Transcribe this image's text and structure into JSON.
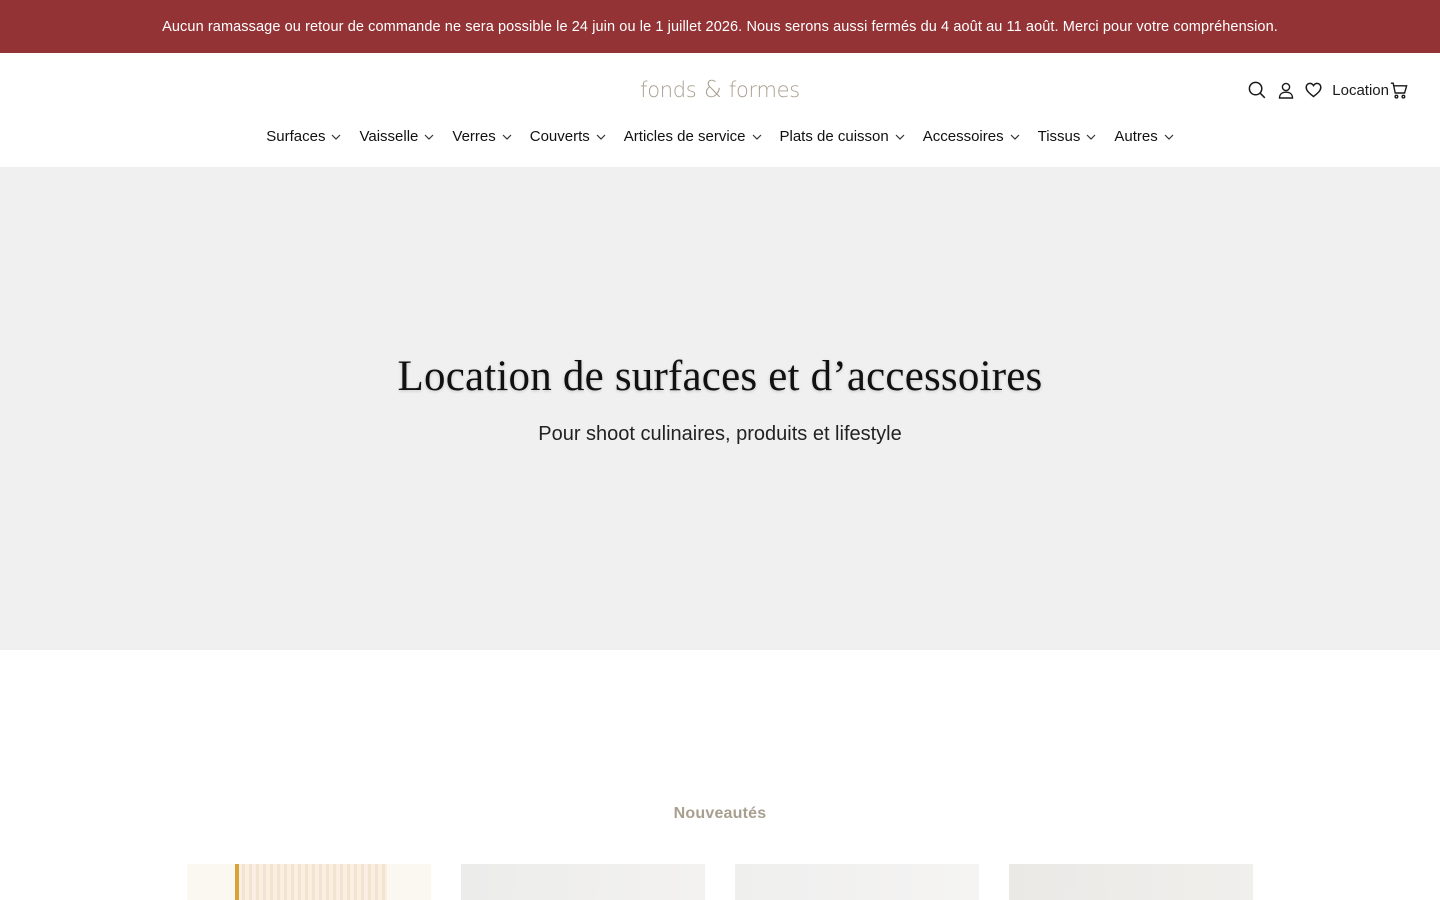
{
  "announcement": {
    "text": "Aucun ramassage ou retour de commande ne sera possible le 24 juin ou le 1 juillet 2026. Nous serons aussi fermés du 4 août au 11 août. Merci pour votre compréhension."
  },
  "header": {
    "logo_left": "fonds",
    "logo_amp": "&",
    "logo_right": "formes",
    "rental_label": "Location",
    "icons": [
      "search-icon",
      "user-icon",
      "heart-icon",
      "cart-icon"
    ]
  },
  "nav": {
    "items": [
      {
        "label": "Surfaces"
      },
      {
        "label": "Vaisselle"
      },
      {
        "label": "Verres"
      },
      {
        "label": "Couverts"
      },
      {
        "label": "Articles de service"
      },
      {
        "label": "Plats de cuisson"
      },
      {
        "label": "Accessoires"
      },
      {
        "label": "Tissus"
      },
      {
        "label": "Autres"
      }
    ]
  },
  "hero": {
    "title": "Location de surfaces et d’accessoires",
    "subtitle": "Pour shoot culinaires, produits et lifestyle"
  },
  "new_arrivals": {
    "title": "Nouveautés"
  },
  "colors": {
    "announcement_bg": "#933336",
    "logo": "#a89f8f",
    "hero_bg": "#f0f0f0",
    "section_title": "#a89f8f"
  }
}
